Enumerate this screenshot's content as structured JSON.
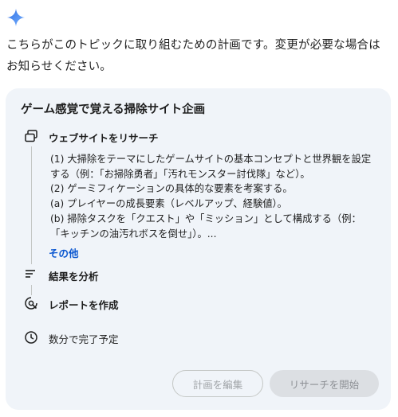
{
  "intro_text": "こちらがこのトピックに取り組むための計画です。変更が必要な場合はお知らせください。",
  "plan": {
    "title": "ゲーム感覚で覚える掃除サイト企画",
    "steps": [
      {
        "label": "ウェブサイトをリサーチ",
        "icon": "web-stack-icon"
      },
      {
        "label": "結果を分析",
        "icon": "analyze-list-icon"
      },
      {
        "label": "レポートを作成",
        "icon": "report-search-icon"
      }
    ],
    "details": [
      "(1) 大掃除をテーマにしたゲームサイトの基本コンセプトと世界観を設定",
      "する（例：「お掃除勇者」「汚れモンスター討伐隊」など）。",
      "(2) ゲーミフィケーションの具体的な要素を考案する。",
      "(a) プレイヤーの成長要素（レベルアップ、経験値）。",
      "(b) 掃除タスクを「クエスト」や「ミッション」として構成する（例：",
      "「キッチンの油汚れボスを倒せ」）。..."
    ],
    "more_label": "その他",
    "eta_label": "数分で完了予定",
    "eta_icon": "clock-icon"
  },
  "buttons": {
    "edit_label": "計画を編集",
    "start_label": "リサーチを開始"
  },
  "colors": {
    "card_bg": "#f0f4f9",
    "link": "#0b57d0",
    "spark_start": "#4285f4",
    "spark_end": "#7ab7ff"
  }
}
